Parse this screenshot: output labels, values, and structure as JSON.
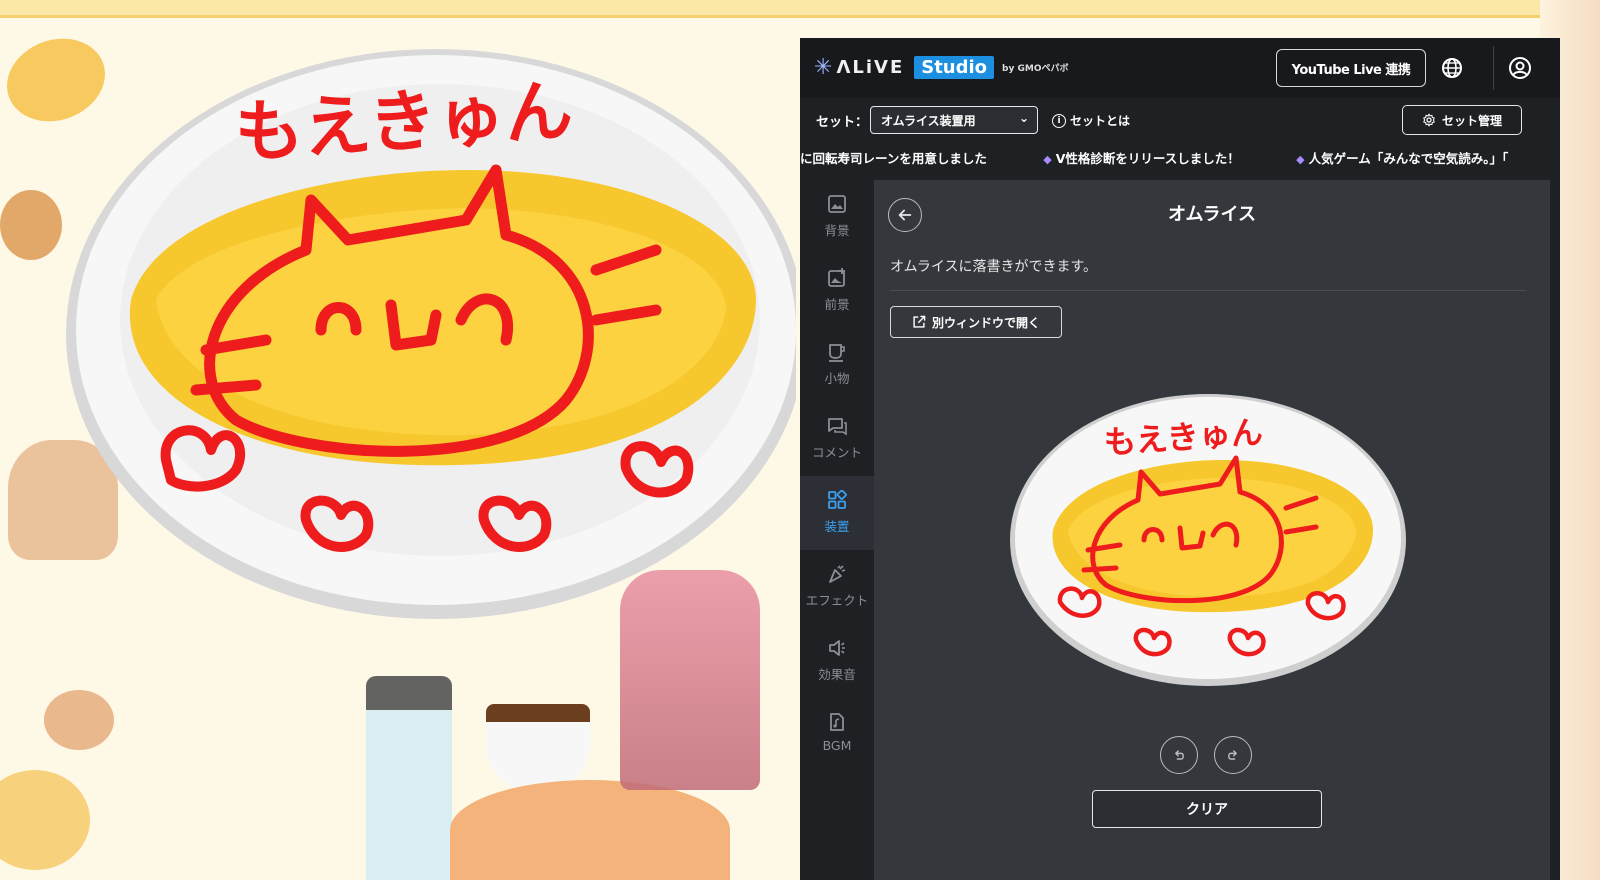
{
  "stage": {
    "omurice_scribble": "もえきゅん",
    "colors": {
      "background": "#fef8e6",
      "egg": "#f6c52b",
      "scribble": "#ee1c1c",
      "plate": "#f4f4f4"
    }
  },
  "header": {
    "logo_alive": "ΛLiVE",
    "logo_studio": "Studio",
    "logo_by": "by GMOペパボ",
    "youtube_button": "YouTube Live 連携",
    "globe_icon": "globe-icon",
    "account_icon": "account-icon"
  },
  "setbar": {
    "label": "セット：",
    "selected_set": "オムライス装置用",
    "info_link": "セットとは",
    "manage_button": "セット管理"
  },
  "ticker": {
    "items": [
      "に回転寿司レーンを用意しました",
      "V性格診断をリリースしました！",
      "人気ゲーム「みんなで空気読み。」「"
    ]
  },
  "sidenav": {
    "items": [
      {
        "label": "背景",
        "icon": "image-icon"
      },
      {
        "label": "前景",
        "icon": "image-plus-icon"
      },
      {
        "label": "小物",
        "icon": "cup-icon"
      },
      {
        "label": "コメント",
        "icon": "comment-icon"
      },
      {
        "label": "装置",
        "icon": "grid-icon",
        "active": true
      },
      {
        "label": "エフェクト",
        "icon": "party-icon"
      },
      {
        "label": "効果音",
        "icon": "speaker-icon"
      },
      {
        "label": "BGM",
        "icon": "music-file-icon"
      }
    ]
  },
  "content": {
    "title": "オムライス",
    "description": "オムライスに落書きができます。",
    "open_window_button": "別ウィンドウで開く",
    "scribble_text": "もえきゅん",
    "clear_button": "クリア",
    "accent": "#3aa0f0"
  }
}
